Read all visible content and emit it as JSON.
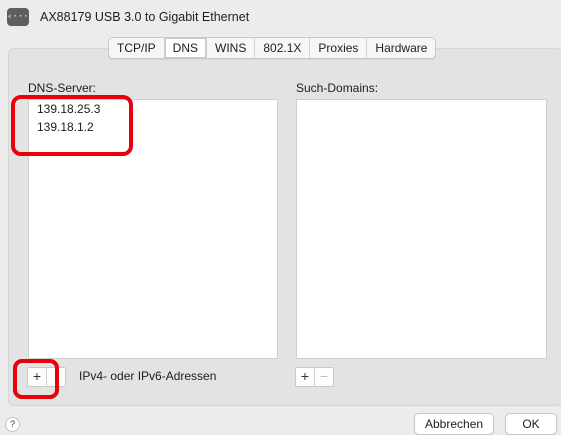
{
  "header": {
    "icon": "network-adapter-icon",
    "icon_glyph": "‹···›",
    "title": "AX88179 USB 3.0 to Gigabit Ethernet"
  },
  "tabs": [
    {
      "label": "TCP/IP",
      "selected": false
    },
    {
      "label": "DNS",
      "selected": true
    },
    {
      "label": "WINS",
      "selected": false
    },
    {
      "label": "802.1X",
      "selected": false
    },
    {
      "label": "Proxies",
      "selected": false
    },
    {
      "label": "Hardware",
      "selected": false
    }
  ],
  "dns": {
    "label": "DNS-Server:",
    "servers": [
      "139.18.25.3",
      "139.18.1.2"
    ],
    "add": "+",
    "hint": "IPv4- oder IPv6-Adressen"
  },
  "search_domains": {
    "label": "Such-Domains:",
    "add": "+",
    "remove": "−"
  },
  "footer": {
    "help": "?",
    "cancel": "Abbrechen",
    "ok": "OK"
  },
  "colors": {
    "highlight": "#e8000b",
    "window_bg": "#ececec",
    "panel_bg": "#e3e3e3"
  }
}
